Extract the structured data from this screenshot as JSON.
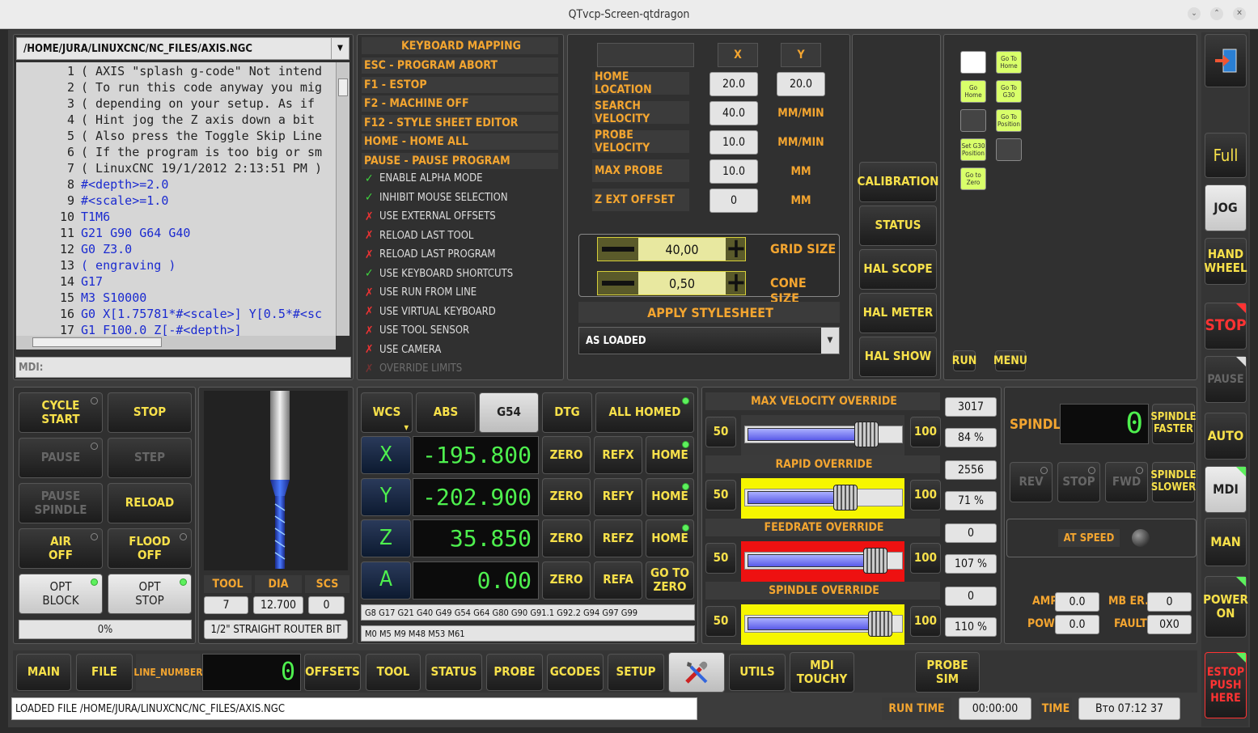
{
  "window": {
    "title": "QTvcp-Screen-qtdragon"
  },
  "file": {
    "path": "/HOME/JURA/LINUXCNC/NC_FILES/AXIS.NGC"
  },
  "code_lines": [
    {
      "n": "1",
      "t": "( AXIS \"splash g-code\" Not intend"
    },
    {
      "n": "2",
      "t": "( To run this code anyway you mig"
    },
    {
      "n": "3",
      "t": "( depending on your setup. As if"
    },
    {
      "n": "4",
      "t": "( Hint jog the Z axis down a bit"
    },
    {
      "n": "5",
      "t": "( Also press the Toggle Skip Line"
    },
    {
      "n": "6",
      "t": "( If the program is too big or sm"
    },
    {
      "n": "7",
      "t": "( LinuxCNC 19/1/2012 2:13:51 PM )"
    },
    {
      "n": "8",
      "t": "#<depth>=2.0"
    },
    {
      "n": "9",
      "t": "#<scale>=1.0"
    },
    {
      "n": "10",
      "t": "T1M6"
    },
    {
      "n": "11",
      "t": "G21 G90 G64 G40"
    },
    {
      "n": "12",
      "t": "G0 Z3.0"
    },
    {
      "n": "13",
      "t": "( engraving )"
    },
    {
      "n": "14",
      "t": "G17"
    },
    {
      "n": "15",
      "t": "M3 S10000"
    },
    {
      "n": "16",
      "t": "G0 X[1.75781*#<scale>] Y[0.5*#<sc"
    },
    {
      "n": "17",
      "t": "G1 F100.0 Z[-#<depth>]"
    }
  ],
  "mdi": {
    "label": "MDI:"
  },
  "keyboard_mapping": {
    "title": "KEYBOARD MAPPING",
    "items": [
      "ESC - PROGRAM ABORT",
      "F1 - ESTOP",
      "F2 - MACHINE OFF",
      "F12 - STYLE SHEET EDITOR",
      "HOME - HOME ALL",
      "PAUSE - PAUSE PROGRAM"
    ]
  },
  "options": [
    {
      "label": "ENABLE ALPHA MODE",
      "checked": true
    },
    {
      "label": "INHIBIT MOUSE SELECTION",
      "checked": true
    },
    {
      "label": "USE EXTERNAL OFFSETS",
      "checked": false
    },
    {
      "label": "RELOAD LAST TOOL",
      "checked": false
    },
    {
      "label": "RELOAD LAST PROGRAM",
      "checked": false
    },
    {
      "label": "USE KEYBOARD SHORTCUTS",
      "checked": true
    },
    {
      "label": "USE RUN FROM LINE",
      "checked": false
    },
    {
      "label": "USE VIRTUAL KEYBOARD",
      "checked": false
    },
    {
      "label": "USE TOOL SENSOR",
      "checked": false
    },
    {
      "label": "USE CAMERA",
      "checked": false
    },
    {
      "label": "OVERRIDE LIMITS",
      "checked": false
    }
  ],
  "probe_table": {
    "col_x": "X",
    "col_y": "Y",
    "rows": [
      {
        "label": "HOME LOCATION",
        "x": "20.0",
        "y": "20.0"
      },
      {
        "label": "SEARCH VELOCITY",
        "x": "40.0",
        "y": "MM/MIN"
      },
      {
        "label": "PROBE VELOCITY",
        "x": "10.0",
        "y": "MM/MIN"
      },
      {
        "label": "MAX PROBE",
        "x": "10.0",
        "y": "MM"
      },
      {
        "label": "Z EXT OFFSET",
        "x": "0",
        "y": "MM"
      }
    ]
  },
  "grid": {
    "grid_value": "40,00",
    "grid_label": "GRID SIZE",
    "cone_value": "0,50",
    "cone_label": "CONE SIZE"
  },
  "stylesheet": {
    "title": "APPLY STYLESHEET",
    "value": "AS LOADED"
  },
  "tools_buttons": [
    "CALIBRATION",
    "STATUS",
    "HAL SCOPE",
    "HAL METER",
    "HAL SHOW"
  ],
  "macro": {
    "icons": [
      "",
      "Go To Home",
      "Go Home",
      "Go To G30",
      "",
      "Go To Position",
      "Set G30 Position",
      "",
      "Go to Zero"
    ],
    "run": "RUN",
    "menu": "MENU"
  },
  "right_nav": {
    "full": "Full",
    "jog": "JOG",
    "handwheel": "HAND\nWHEEL",
    "stop": "STOP",
    "pause": "PAUSE",
    "auto": "AUTO",
    "mdi": "MDI",
    "man": "MAN",
    "power": "POWER\nON",
    "estop": "ESTOP\nPUSH\nHERE"
  },
  "cycle": {
    "cycle_start": "CYCLE\nSTART",
    "stop": "STOP",
    "pause": "PAUSE",
    "step": "STEP",
    "pause_spindle": "PAUSE\nSPINDLE",
    "reload": "RELOAD",
    "air_off": "AIR\nOFF",
    "flood_off": "FLOOD\nOFF",
    "opt_block": "OPT\nBLOCK",
    "opt_stop": "OPT\nSTOP",
    "progress": "0%"
  },
  "tool": {
    "h_tool": "TOOL",
    "h_dia": "DIA",
    "h_scs": "SCS",
    "tool": "7",
    "dia": "12.700",
    "scs": "0",
    "name": "1/2\" STRAIGHT ROUTER BIT"
  },
  "dro": {
    "wcs": "WCS",
    "abs": "ABS",
    "g54": "G54",
    "dtg": "DTG",
    "all_homed": "ALL HOMED",
    "axes": [
      {
        "axis": "X",
        "value": "-195.800",
        "zero": "ZERO",
        "ref": "REFX",
        "home": "HOME"
      },
      {
        "axis": "Y",
        "value": "-202.900",
        "zero": "ZERO",
        "ref": "REFY",
        "home": "HOME"
      },
      {
        "axis": "Z",
        "value": "35.850",
        "zero": "ZERO",
        "ref": "REFZ",
        "home": "HOME"
      },
      {
        "axis": "A",
        "value": "0.00",
        "zero": "ZERO",
        "ref": "REFA",
        "home": "GO TO\nZERO"
      }
    ],
    "gcodes": "G8 G17 G21 G40 G49 G54 G64 G80 G90 G91.1 G92.2 G94 G97 G99",
    "mcodes": "M0 M5 M9 M48 M53 M61"
  },
  "overrides": [
    {
      "title": "MAX VELOCITY OVERRIDE",
      "min": "50",
      "max": "100",
      "value": "3017",
      "percent": "84 %",
      "level": 0.84,
      "band": "#3a3a3a"
    },
    {
      "title": "RAPID OVERRIDE",
      "min": "50",
      "max": "100",
      "value": "2556",
      "percent": "71 %",
      "level": 0.71,
      "band": "#f6f600"
    },
    {
      "title": "FEEDRATE OVERRIDE",
      "min": "50",
      "max": "100",
      "value": "0",
      "percent": "107 %",
      "level": 0.9,
      "band": "#ee1111"
    },
    {
      "title": "SPINDLE OVERRIDE",
      "min": "50",
      "max": "100",
      "value": "0",
      "percent": "110 %",
      "level": 0.93,
      "band": "#f6f600"
    }
  ],
  "spindle": {
    "label": "SPINDLE",
    "rpm": "0",
    "faster": "SPINDLE\nFASTER",
    "slower": "SPINDLE\nSLOWER",
    "rev": "REV",
    "stop": "STOP",
    "fwd": "FWD",
    "at_speed": "AT SPEED",
    "amps_label": "AMPS",
    "amps": "0.0",
    "mber_label": "MB ER.",
    "mber": "0",
    "power_label": "POWER",
    "power": "0.0",
    "fault_label": "FAULT",
    "fault": "0X0"
  },
  "bottom_tabs": {
    "main": "MAIN",
    "file": "FILE",
    "line_number": "LINE_NUMBER",
    "line_value": "0",
    "offsets": "OFFSETS",
    "tool": "TOOL",
    "status": "STATUS",
    "probe": "PROBE",
    "gcodes": "GCODES",
    "setup": "SETUP",
    "utils": "UTILS",
    "mdi_touchy": "MDI\nTOUCHY",
    "probe_sim": "PROBE\nSIM"
  },
  "statusbar": {
    "message": "LOADED FILE /HOME/JURA/LINUXCNC/NC_FILES/AXIS.NGC",
    "run_time_label": "RUN TIME",
    "run_time": "00:00:00",
    "time_label": "TIME",
    "time": "Вто 07:12 37"
  },
  "colors": {
    "accent": "#f3a530",
    "button_text": "#f7e04a",
    "led_green": "#5df05d",
    "lcd_green": "#4ef04e"
  }
}
